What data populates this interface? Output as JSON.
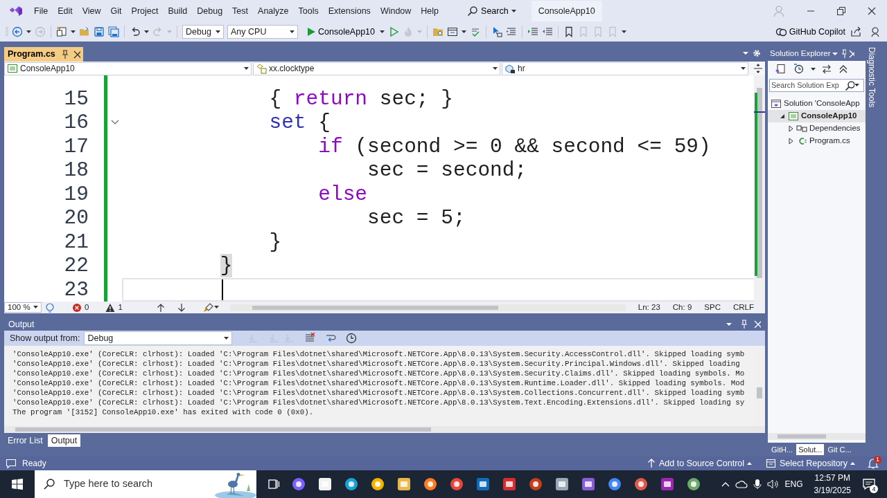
{
  "title_bar": {
    "menus": [
      "File",
      "Edit",
      "View",
      "Git",
      "Project",
      "Build",
      "Debug",
      "Test",
      "Analyze",
      "Tools",
      "Extensions",
      "Window",
      "Help"
    ],
    "search": "Search",
    "solution_name": "ConsoleApp10"
  },
  "toolbar": {
    "configuration": "Debug",
    "platform": "Any CPU",
    "start_target": "ConsoleApp10",
    "copilot": "GitHub Copilot"
  },
  "document_tabs": [
    {
      "label": "Program.cs",
      "selected": true
    }
  ],
  "navigation_bar": {
    "project": "ConsoleApp10",
    "type": "xx.clocktype",
    "member": "hr"
  },
  "editor": {
    "lines": [
      {
        "number": "15",
        "current": false,
        "fold_marker": false,
        "tokens": [
          {
            "text": "            { ",
            "kind": "plain"
          },
          {
            "text": "return",
            "kind": "control"
          },
          {
            "text": " sec; }",
            "kind": "plain"
          }
        ]
      },
      {
        "number": "16",
        "current": false,
        "fold_marker": true,
        "tokens": [
          {
            "text": "            set",
            "kind": "keyword"
          },
          {
            "text": " {",
            "kind": "plain"
          }
        ]
      },
      {
        "number": "17",
        "current": false,
        "fold_marker": false,
        "tokens": [
          {
            "text": "                if",
            "kind": "control"
          },
          {
            "text": " (second >= 0 && second <= 59)",
            "kind": "plain"
          }
        ]
      },
      {
        "number": "18",
        "current": false,
        "fold_marker": false,
        "tokens": [
          {
            "text": "                    sec = second;",
            "kind": "plain"
          }
        ]
      },
      {
        "number": "19",
        "current": false,
        "fold_marker": false,
        "tokens": [
          {
            "text": "                else",
            "kind": "control"
          }
        ]
      },
      {
        "number": "20",
        "current": false,
        "fold_marker": false,
        "tokens": [
          {
            "text": "                    sec = 5;",
            "kind": "plain"
          }
        ]
      },
      {
        "number": "21",
        "current": false,
        "fold_marker": false,
        "tokens": [
          {
            "text": "            }",
            "kind": "plain"
          }
        ]
      },
      {
        "number": "22",
        "current": false,
        "fold_marker": false,
        "tokens": [
          {
            "text": "        }",
            "kind": "matched-brace"
          }
        ]
      },
      {
        "number": "23",
        "current": true,
        "fold_marker": false
      }
    ]
  },
  "editor_status": {
    "zoom": "100 %",
    "errors": "0",
    "warnings": "1",
    "line": "Ln: 23",
    "column": "Ch: 9",
    "indent": "SPC",
    "line_ending": "CRLF"
  },
  "output": {
    "title": "Output",
    "show_from_label": "Show output from:",
    "source": "Debug",
    "lines": [
      "'ConsoleApp10.exe' (CoreCLR: clrhost): Loaded 'C:\\Program Files\\dotnet\\shared\\Microsoft.NETCore.App\\8.0.13\\System.Security.AccessControl.dll'. Skipped loading symb",
      "'ConsoleApp10.exe' (CoreCLR: clrhost): Loaded 'C:\\Program Files\\dotnet\\shared\\Microsoft.NETCore.App\\8.0.13\\System.Security.Principal.Windows.dll'. Skipped loading",
      "'ConsoleApp10.exe' (CoreCLR: clrhost): Loaded 'C:\\Program Files\\dotnet\\shared\\Microsoft.NETCore.App\\8.0.13\\System.Security.Claims.dll'. Skipped loading symbols. Mo",
      "'ConsoleApp10.exe' (CoreCLR: clrhost): Loaded 'C:\\Program Files\\dotnet\\shared\\Microsoft.NETCore.App\\8.0.13\\System.Runtime.Loader.dll'. Skipped loading symbols. Mod",
      "'ConsoleApp10.exe' (CoreCLR: clrhost): Loaded 'C:\\Program Files\\dotnet\\shared\\Microsoft.NETCore.App\\8.0.13\\System.Collections.Concurrent.dll'. Skipped loading symb",
      "'ConsoleApp10.exe' (CoreCLR: clrhost): Loaded 'C:\\Program Files\\dotnet\\shared\\Microsoft.NETCore.App\\8.0.13\\System.Text.Encoding.Extensions.dll'. Skipped loading sy",
      "The program '[3152] ConsoleApp10.exe' has exited with code 0 (0x0)."
    ]
  },
  "bottom_tabs": [
    {
      "label": "Error List",
      "selected": false
    },
    {
      "label": "Output",
      "selected": true
    }
  ],
  "solution_explorer": {
    "title": "Solution Explorer",
    "search_placeholder": "Search Solution Exp",
    "tree": [
      {
        "label": "Solution 'ConsoleApp",
        "kind": "solution",
        "selected": false,
        "children": [
          {
            "label": "ConsoleApp10",
            "kind": "project",
            "selected": true,
            "expanded": true,
            "children": [
              {
                "label": "Dependencies",
                "kind": "dependencies",
                "selected": false,
                "expanded": false
              },
              {
                "label": "Program.cs",
                "kind": "csharp-file",
                "selected": false,
                "expanded": false
              }
            ]
          }
        ]
      }
    ]
  },
  "side_tabs": [
    {
      "label": "GitH...",
      "selected": false
    },
    {
      "label": "Solut...",
      "selected": true
    },
    {
      "label": "Git C...",
      "selected": false
    }
  ],
  "side_panel": "Diagnostic Tools",
  "status_bar": {
    "state": "Ready",
    "source_control": "Add to Source Control",
    "repository": "Select Repository",
    "notifications": "1"
  },
  "taskbar": {
    "search_placeholder": "Type here to search",
    "language": "ENG",
    "time": "12:57 PM",
    "date": "3/19/2025",
    "notifications": "4"
  }
}
